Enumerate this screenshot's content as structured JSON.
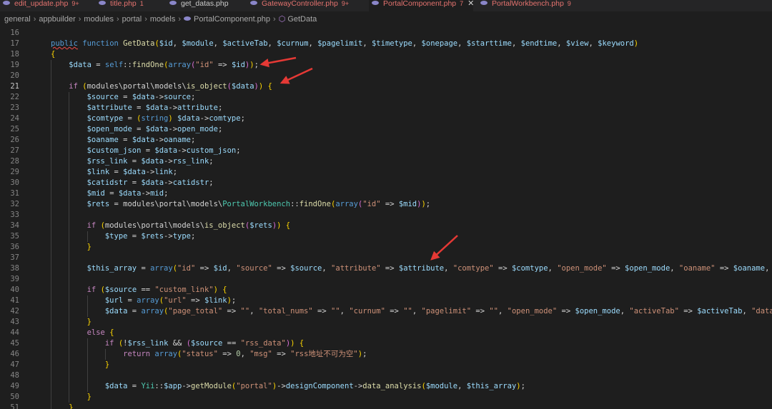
{
  "tabs": [
    {
      "label": "edit_update.php",
      "badge": "9+",
      "active": false,
      "plain": false
    },
    {
      "label": "title.php",
      "badge": "1",
      "active": false,
      "plain": false
    },
    {
      "label": "get_datas.php",
      "badge": "",
      "active": false,
      "plain": true
    },
    {
      "label": "GatewayController.php",
      "badge": "9+",
      "active": false,
      "plain": false
    },
    {
      "label": "PortalComponent.php",
      "badge": "7",
      "active": true,
      "plain": false
    },
    {
      "label": "PortalWorkbench.php",
      "badge": "9",
      "active": false,
      "plain": false
    }
  ],
  "close_glyph": "✕",
  "breadcrumb": [
    "general",
    "appbuilder",
    "modules",
    "portal",
    "models",
    "PortalComponent.php",
    "GetData"
  ],
  "line_numbers": [
    "16",
    "17",
    "18",
    "19",
    "20",
    "21",
    "22",
    "23",
    "24",
    "25",
    "26",
    "27",
    "28",
    "29",
    "30",
    "31",
    "32",
    "33",
    "34",
    "35",
    "36",
    "37",
    "38",
    "39",
    "40",
    "41",
    "42",
    "43",
    "44",
    "45",
    "46",
    "47",
    "48",
    "49",
    "50",
    "51"
  ],
  "current_line": "21",
  "code_lines": [
    "",
    "public function GetData($id, $module, $activeTab, $curnum, $pagelimit, $timetype, $onepage, $starttime, $endtime, $view, $keyword)",
    "{",
    "    $data = self::findOne(array(\"id\" => $id));",
    "",
    "    if (modules\\portal\\models\\is_object($data)) {",
    "        $source = $data->source;",
    "        $attribute = $data->attribute;",
    "        $comtype = (string) $data->comtype;",
    "        $open_mode = $data->open_mode;",
    "        $oaname = $data->oaname;",
    "        $custom_json = $data->custom_json;",
    "        $rss_link = $data->rss_link;",
    "        $link = $data->link;",
    "        $catidstr = $data->catidstr;",
    "        $mid = $data->mid;",
    "        $rets = modules\\portal\\models\\PortalWorkbench::findOne(array(\"id\" => $mid));",
    "",
    "        if (modules\\portal\\models\\is_object($rets)) {",
    "            $type = $rets->type;",
    "        }",
    "",
    "        $this_array = array(\"id\" => $id, \"source\" => $source, \"attribute\" => $attribute, \"comtype\" => $comtype, \"open_mode\" => $open_mode, \"oaname\" => $oaname, \"custo",
    "",
    "        if ($source == \"custom_link\") {",
    "            $url = array(\"url\" => $link);",
    "            $data = array(\"page_total\" => \"\", \"total_nums\" => \"\", \"curnum\" => \"\", \"pagelimit\" => \"\", \"open_mode\" => $open_mode, \"activeTab\" => $activeTab, \"data_sourc",
    "        }",
    "        else {",
    "            if (!$rss_link && ($source == \"rss_data\")) {",
    "                return array(\"status\" => 0, \"msg\" => \"rss地址不可为空\");",
    "            }",
    "",
    "            $data = Yii::$app->getModule(\"portal\")->designComponent->data_analysis($module, $this_array);",
    "        }",
    "    }"
  ],
  "annotation_color": "#e53935"
}
